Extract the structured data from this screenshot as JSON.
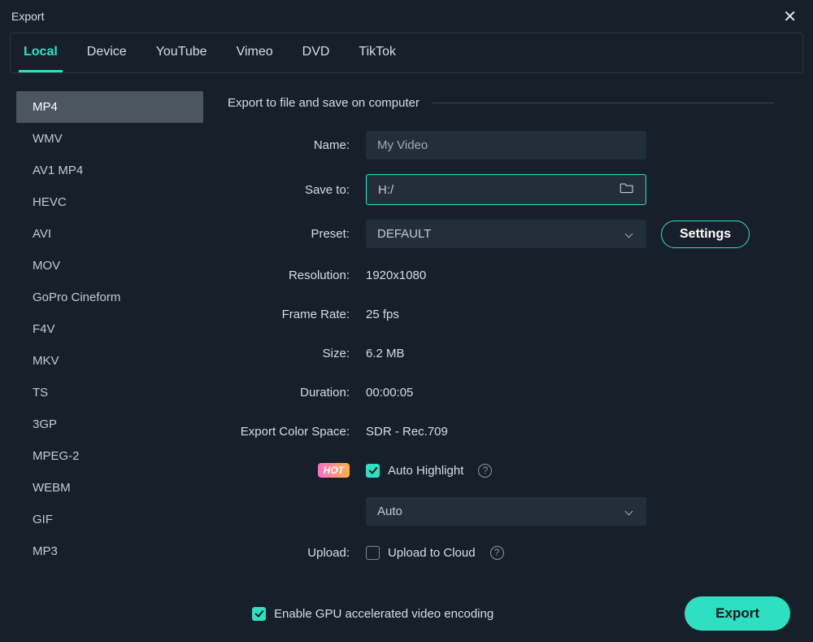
{
  "window": {
    "title": "Export"
  },
  "tabs": [
    {
      "label": "Local",
      "active": true
    },
    {
      "label": "Device",
      "active": false
    },
    {
      "label": "YouTube",
      "active": false
    },
    {
      "label": "Vimeo",
      "active": false
    },
    {
      "label": "DVD",
      "active": false
    },
    {
      "label": "TikTok",
      "active": false
    }
  ],
  "formats": [
    {
      "label": "MP4",
      "selected": true
    },
    {
      "label": "WMV"
    },
    {
      "label": "AV1 MP4"
    },
    {
      "label": "HEVC"
    },
    {
      "label": "AVI"
    },
    {
      "label": "MOV"
    },
    {
      "label": "GoPro Cineform"
    },
    {
      "label": "F4V"
    },
    {
      "label": "MKV"
    },
    {
      "label": "TS"
    },
    {
      "label": "3GP"
    },
    {
      "label": "MPEG-2"
    },
    {
      "label": "WEBM"
    },
    {
      "label": "GIF"
    },
    {
      "label": "MP3"
    }
  ],
  "sectionTitle": "Export to file and save on computer",
  "fields": {
    "name": {
      "label": "Name:",
      "value": "My Video"
    },
    "saveTo": {
      "label": "Save to:",
      "value": "H:/"
    },
    "preset": {
      "label": "Preset:",
      "value": "DEFAULT",
      "settings": "Settings"
    },
    "resolution": {
      "label": "Resolution:",
      "value": "1920x1080"
    },
    "frameRate": {
      "label": "Frame Rate:",
      "value": "25 fps"
    },
    "size": {
      "label": "Size:",
      "value": "6.2 MB"
    },
    "duration": {
      "label": "Duration:",
      "value": "00:00:05"
    },
    "colorSpace": {
      "label": "Export Color Space:",
      "value": "SDR - Rec.709"
    },
    "autoHl": {
      "badge": "HOT",
      "label": "Auto Highlight",
      "checked": true,
      "select": "Auto"
    },
    "upload": {
      "label": "Upload:",
      "chkLabel": "Upload to Cloud",
      "checked": false
    }
  },
  "footer": {
    "gpu": {
      "label": "Enable GPU accelerated video encoding",
      "checked": true
    },
    "exportBtn": "Export"
  }
}
